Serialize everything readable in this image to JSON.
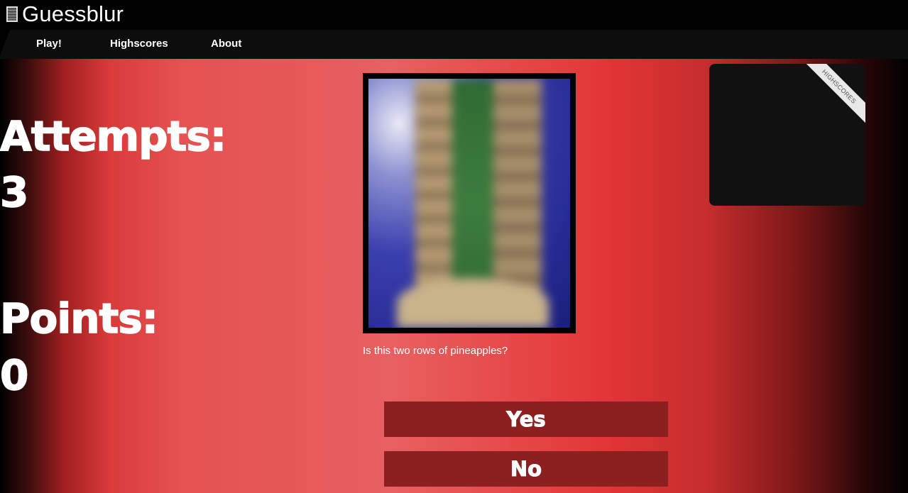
{
  "app": {
    "title": "Guessblur",
    "icon": "calculator-icon"
  },
  "nav": {
    "items": [
      {
        "label": "Play!"
      },
      {
        "label": "Highscores"
      },
      {
        "label": "About"
      }
    ]
  },
  "stats": {
    "attempts_label": "Attempts:",
    "attempts_value": "3",
    "points_label": "Points:",
    "points_value": "0"
  },
  "game": {
    "question": "Is this two rows of pineapples?",
    "yes_label": "Yes",
    "no_label": "No"
  },
  "highscores_panel": {
    "ribbon_label": "HIGHSCORES"
  },
  "colors": {
    "button": "#8c1f1f",
    "topbar": "#000000",
    "navbar": "#0d0d0d",
    "panel": "#111111"
  }
}
